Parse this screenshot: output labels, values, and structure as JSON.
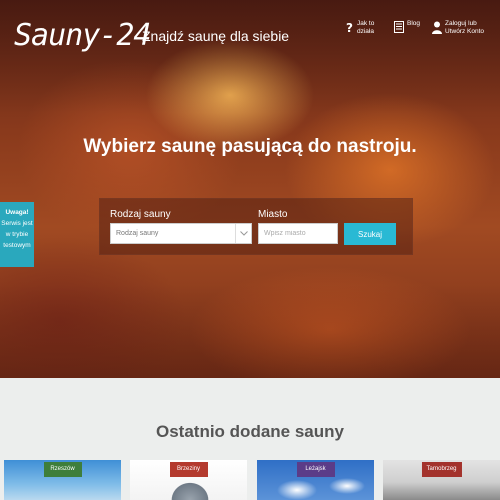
{
  "header": {
    "logo": "Sauny-24",
    "tagline": "Znajdź saunę dla siebie",
    "nav": [
      {
        "label": "Jak to\ndziała",
        "icon": "question-icon"
      },
      {
        "label": "Blog",
        "icon": "blog-icon"
      },
      {
        "label": "Zaloguj lub\nUtwórz Konto",
        "icon": "user-icon"
      }
    ]
  },
  "hero": {
    "headline_prefix": "Wybierz ",
    "headline_bold": "saunę",
    "headline_suffix": " pasującą do nastroju."
  },
  "search": {
    "type_label": "Rodzaj sauny",
    "type_placeholder": "Rodzaj sauny",
    "city_label": "Miasto",
    "city_placeholder": "Wpisz miasto",
    "button": "Szukaj"
  },
  "notice": {
    "title": "Uwaga!",
    "body": "Serwis jest w trybie testowym"
  },
  "recent": {
    "title": "Ostatnio dodane sauny",
    "cards": [
      {
        "city": "Rzeszów",
        "badge_color": "#3e7e3b"
      },
      {
        "city": "Brzeziny",
        "badge_color": "#b43a2e"
      },
      {
        "city": "Leżajsk",
        "badge_color": "#5b3c88"
      },
      {
        "city": "Tarnobrzeg",
        "badge_color": "#a3322c"
      }
    ]
  },
  "colors": {
    "accent": "#29b9d4",
    "notice": "#2aa8bd"
  }
}
